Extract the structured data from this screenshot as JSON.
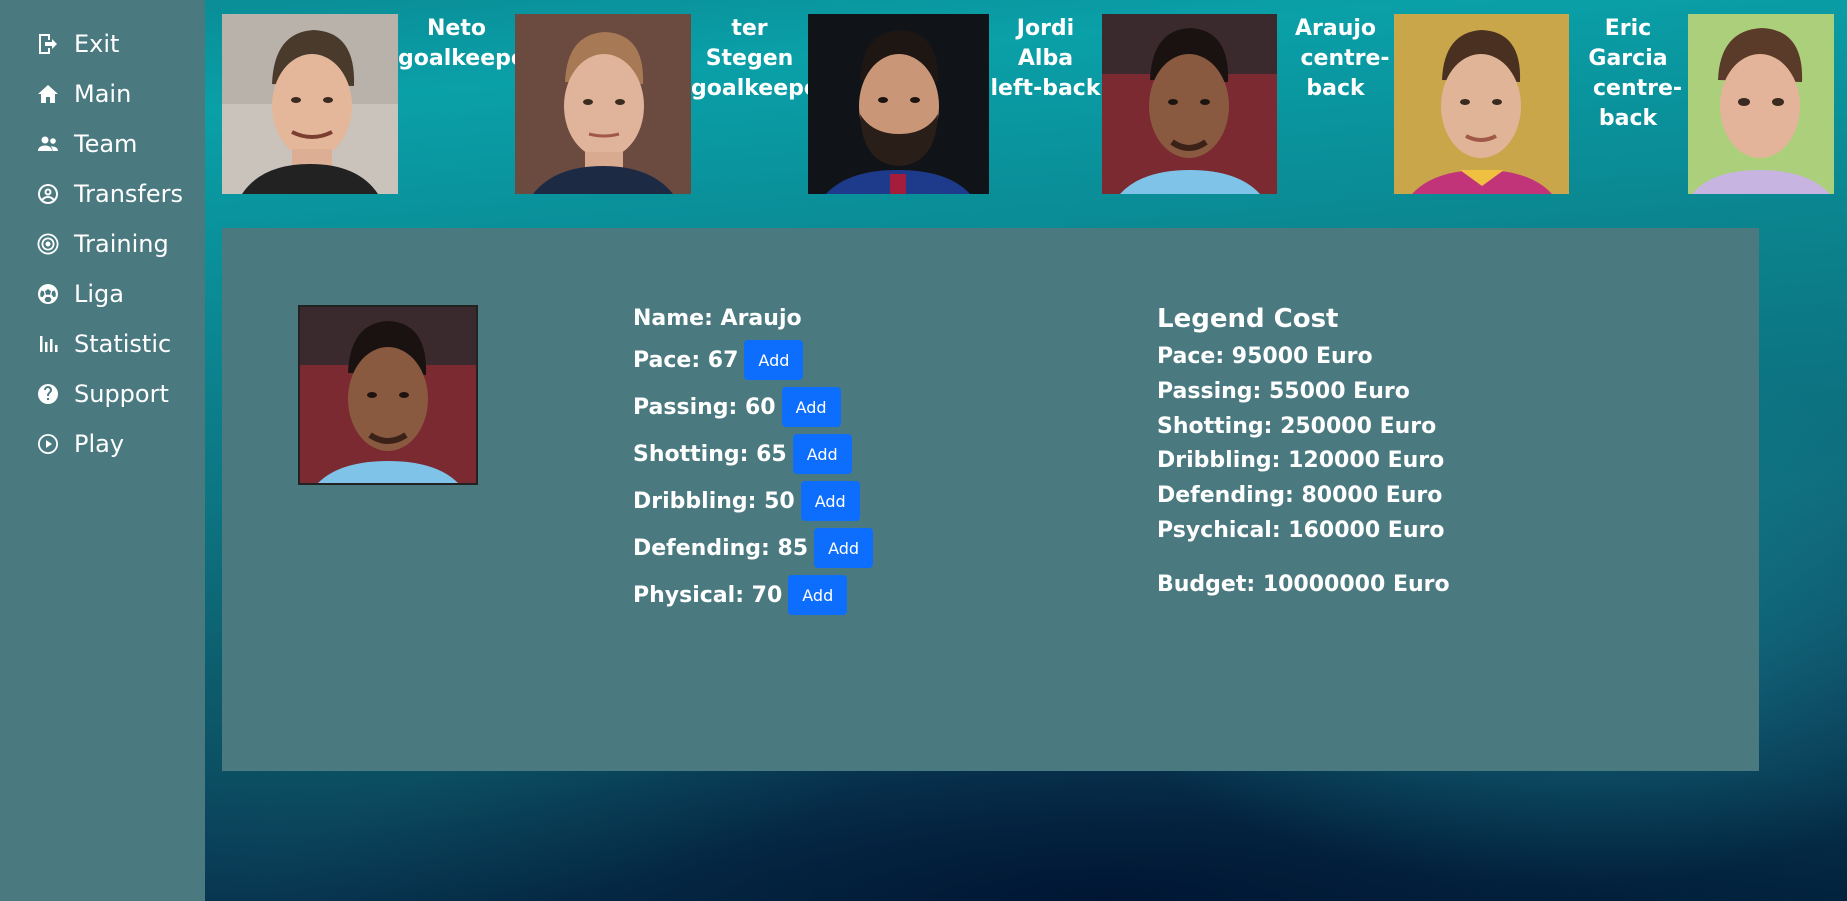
{
  "sidebar": {
    "items": [
      {
        "label": "Exit",
        "icon": "exit-icon"
      },
      {
        "label": "Main",
        "icon": "home-icon"
      },
      {
        "label": "Team",
        "icon": "team-icon"
      },
      {
        "label": "Transfers",
        "icon": "user-circle-icon"
      },
      {
        "label": "Training",
        "icon": "target-icon"
      },
      {
        "label": "Liga",
        "icon": "soccer-ball-icon"
      },
      {
        "label": "Statistic",
        "icon": "bar-chart-icon"
      },
      {
        "label": "Support",
        "icon": "question-icon"
      },
      {
        "label": "Play",
        "icon": "play-icon"
      }
    ]
  },
  "players": [
    {
      "name": "Neto",
      "position": "goalkeeper"
    },
    {
      "name": "ter Stegen",
      "position": "goalkeeper"
    },
    {
      "name": "Jordi Alba",
      "position": "left-back"
    },
    {
      "name": "Araujo",
      "position": "centre-back"
    },
    {
      "name": "Eric Garcia",
      "position": "centre-back"
    },
    {
      "name": "",
      "position": ""
    }
  ],
  "detail": {
    "name_line": "Name: Araujo",
    "stats": [
      {
        "label": "Pace: 67",
        "button": "Add"
      },
      {
        "label": "Passing: 60",
        "button": "Add"
      },
      {
        "label": "Shotting: 65",
        "button": "Add"
      },
      {
        "label": "Dribbling: 50",
        "button": "Add"
      },
      {
        "label": "Defending: 85",
        "button": "Add"
      },
      {
        "label": "Physical: 70",
        "button": "Add"
      }
    ],
    "cost_title": "Legend Cost",
    "costs": [
      "Pace: 95000 Euro",
      "Passing: 55000 Euro",
      "Shotting: 250000 Euro",
      "Dribbling: 120000 Euro",
      "Defending: 80000 Euro",
      "Psychical: 160000 Euro"
    ],
    "budget": "Budget: 10000000 Euro"
  },
  "colors": {
    "sidebar": "#4a7a80",
    "panel": "#4a7a80",
    "button": "#0d6efd"
  }
}
